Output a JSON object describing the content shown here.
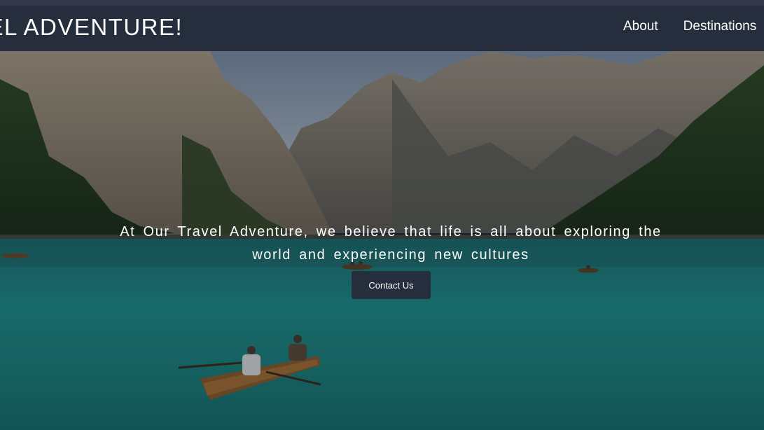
{
  "header": {
    "brand": "VEL ADVENTURE!",
    "nav": [
      {
        "label": "About"
      },
      {
        "label": "Destinations"
      }
    ]
  },
  "hero": {
    "tagline": "At Our Travel Adventure, we believe that life is all about exploring the world and experiencing new cultures",
    "cta_label": "Contact Us",
    "image_subject": "mountain-lake-with-rowboats"
  },
  "colors": {
    "navbar": "#262d3c",
    "button": "#262d3c",
    "text": "#ffffff",
    "lake": "#1f8f8c"
  }
}
